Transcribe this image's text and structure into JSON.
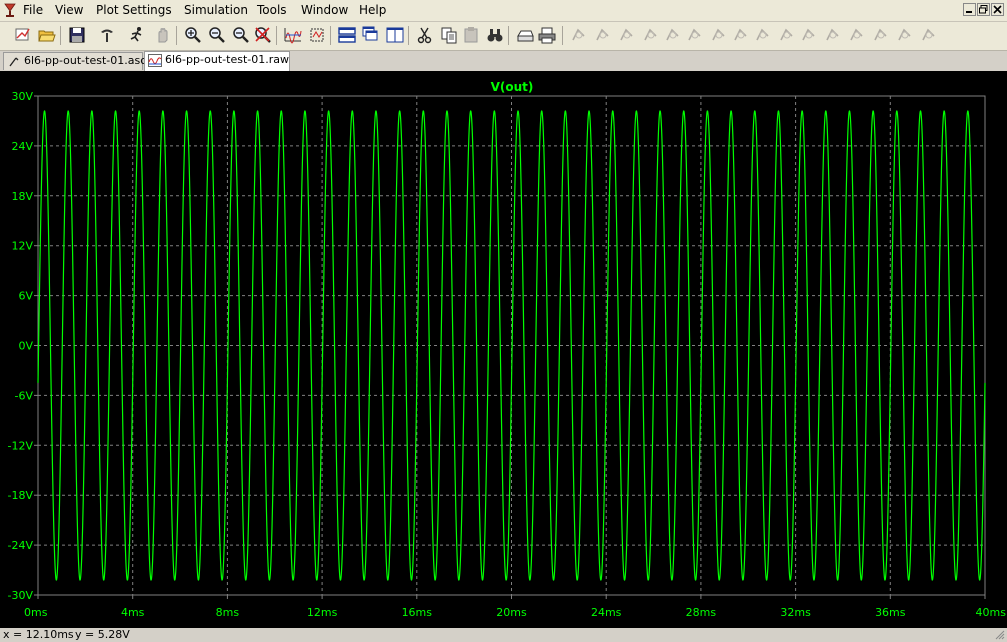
{
  "menu": [
    "File",
    "View",
    "Plot Settings",
    "Simulation",
    "Tools",
    "Window",
    "Help"
  ],
  "window_controls": [
    "minimize",
    "restore",
    "close"
  ],
  "toolbar": [
    "run-icon",
    "open-icon",
    "save-icon",
    "control-panel-icon",
    "run-sim-icon",
    "halt-icon",
    "zoom-in-icon",
    "zoom-out-icon",
    "zoom-area-icon",
    "cancel-zoom-icon",
    "autorange-icon",
    "fit-icon",
    "tile-horizontal-icon",
    "cascade-icon",
    "tile-vertical-icon",
    "cut-icon",
    "copy-icon",
    "paste-icon",
    "find-icon",
    "print-preview-icon",
    "print-icon",
    "wire-icon",
    "ground-icon",
    "label-icon",
    "resistor-icon",
    "capacitor-icon",
    "inductor-icon",
    "diode-icon",
    "component-icon",
    "move-icon",
    "drag-icon",
    "undo-icon",
    "redo-icon",
    "rotate-icon",
    "mirror-icon",
    "text-icon",
    "spice-directive-icon"
  ],
  "tabs": [
    {
      "label": "6l6-pp-out-test-01.asc",
      "active": false
    },
    {
      "label": "6l6-pp-out-test-01.raw",
      "active": true
    }
  ],
  "status": {
    "x_label": "x = 12.10ms",
    "y_label": "y = 5.28V"
  },
  "colors": {
    "plot_bg": "#000000",
    "trace": "#00ff00",
    "grid": "#808080",
    "axis_text": "#00ff00"
  },
  "chart_data": {
    "type": "line",
    "title": "V(out)",
    "xlabel": "",
    "ylabel": "",
    "x_unit": "ms",
    "y_unit": "V",
    "xlim": [
      0,
      40
    ],
    "ylim": [
      -30,
      30
    ],
    "x_ticks": [
      0,
      4,
      8,
      12,
      16,
      20,
      24,
      28,
      32,
      36,
      40
    ],
    "y_ticks": [
      30,
      24,
      18,
      12,
      6,
      0,
      -6,
      -12,
      -18,
      -24,
      -30
    ],
    "x_tick_labels": [
      "0ms",
      "4ms",
      "8ms",
      "12ms",
      "16ms",
      "20ms",
      "24ms",
      "28ms",
      "32ms",
      "36ms",
      "40ms"
    ],
    "y_tick_labels": [
      "30V",
      "24V",
      "18V",
      "12V",
      "6V",
      "0V",
      "-6V",
      "-12V",
      "-18V",
      "-24V",
      "-30V"
    ],
    "grid": true,
    "series": [
      {
        "name": "V(out)",
        "waveform": "sine",
        "amplitude": 28.2,
        "frequency_khz": 1.0,
        "offset": 0,
        "start_value": -4.5,
        "end_value": 2.5
      }
    ]
  }
}
